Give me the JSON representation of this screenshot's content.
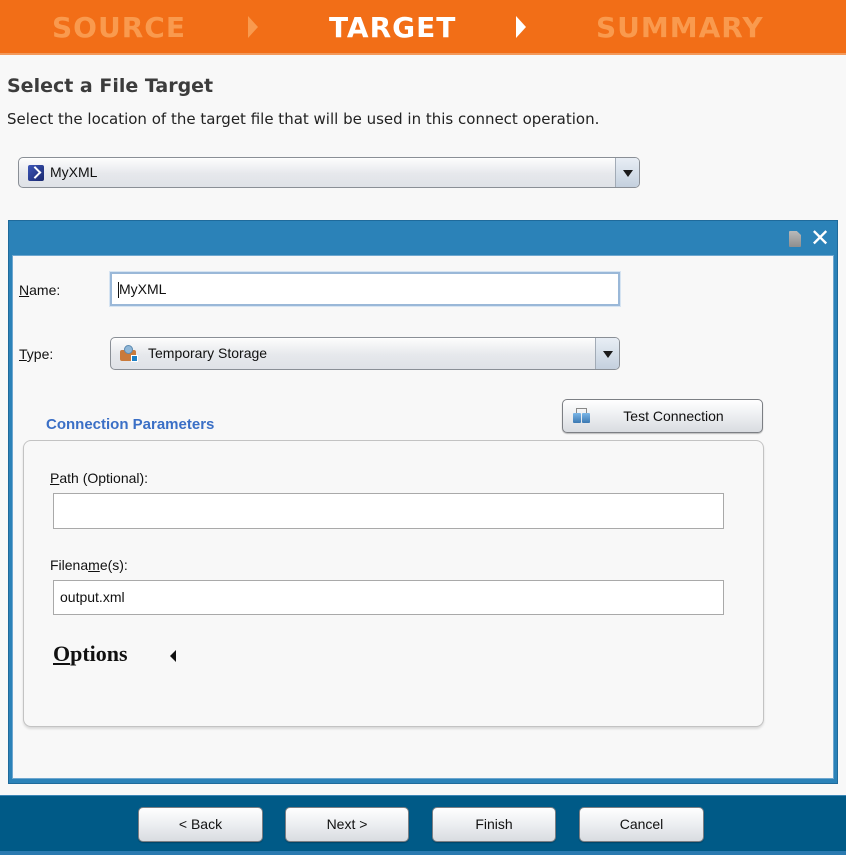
{
  "wizard_steps": [
    {
      "label": "SOURCE",
      "state": "inactive"
    },
    {
      "label": "TARGET",
      "state": "active"
    },
    {
      "label": "SUMMARY",
      "state": "inactive"
    }
  ],
  "page": {
    "title": "Select a File Target",
    "subtitle": "Select the location of the target file that will be used in this connect operation."
  },
  "target_select": {
    "value": "MyXML",
    "icon": "xml-file-icon"
  },
  "panel": {
    "save_icon": "save-icon",
    "close_label": "✕",
    "name": {
      "label_accel": "N",
      "label_rest": "ame:",
      "value": "MyXML"
    },
    "type": {
      "label_accel": "T",
      "label_rest": "ype:",
      "value": "Temporary Storage",
      "icon": "temporary-storage-icon"
    },
    "connection_parameters": {
      "title": "Connection Parameters",
      "test_button": "Test Connection",
      "path": {
        "label_accel": "P",
        "label_rest": "ath (Optional):",
        "value": ""
      },
      "filename": {
        "label_pre": "Filena",
        "label_accel": "m",
        "label_rest": "e(s):",
        "value": "output.xml"
      },
      "options": {
        "label_accel": "O",
        "label_rest": "ptions",
        "expanded": false
      }
    }
  },
  "footer": {
    "back": "< Back",
    "next": "Next >",
    "finish": "Finish",
    "cancel": "Cancel"
  },
  "colors": {
    "header_orange": "#f26e17",
    "panel_blue": "#2b82b8",
    "footer_blue": "#005a87",
    "section_title_blue": "#3a6fc6"
  }
}
